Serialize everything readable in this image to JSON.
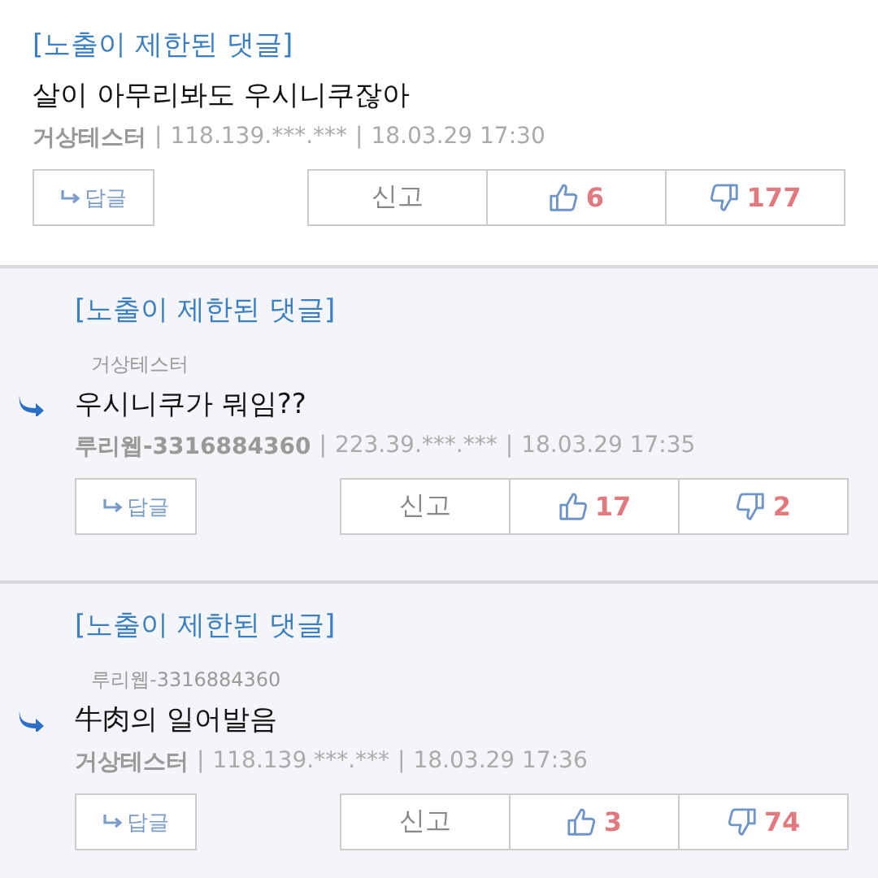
{
  "comments": [
    {
      "kind": "comment",
      "label": "[노출이 제한된 댓글]",
      "text": "살이 아무리봐도 우시니쿠잖아",
      "author": "거상테스터",
      "separator": "|",
      "ip": "118.139.***.***",
      "date": "18.03.29 17:30",
      "reply_button": "답글",
      "report_button": "신고",
      "likes": "6",
      "dislikes": "177"
    },
    {
      "kind": "reply",
      "label": "[노출이 제한된 댓글]",
      "mention": "거상테스터",
      "text": "우시니쿠가 뭐임??",
      "author": "루리웹-3316884360",
      "separator": "|",
      "ip": "223.39.***.***",
      "date": "18.03.29 17:35",
      "reply_button": "답글",
      "report_button": "신고",
      "likes": "17",
      "dislikes": "2"
    },
    {
      "kind": "reply",
      "label": "[노출이 제한된 댓글]",
      "mention": "루리웹-3316884360",
      "text": "牛肉의 일어발음",
      "author": "거상테스터",
      "separator": "|",
      "ip": "118.139.***.***",
      "date": "18.03.29 17:36",
      "reply_button": "답글",
      "report_button": "신고",
      "likes": "3",
      "dislikes": "74"
    }
  ]
}
